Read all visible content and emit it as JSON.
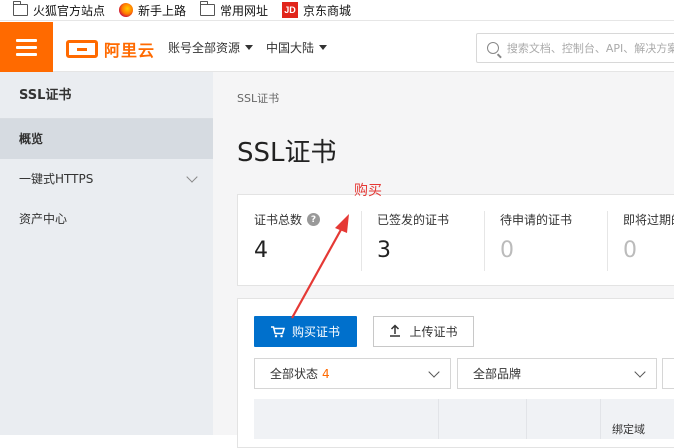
{
  "bookmarks": [
    {
      "label": "火狐官方站点",
      "icon": "folder-icon"
    },
    {
      "label": "新手上路",
      "icon": "firefox-icon"
    },
    {
      "label": "常用网址",
      "icon": "folder-icon"
    },
    {
      "label": "京东商城",
      "icon": "jd-icon",
      "icon_text": "JD"
    }
  ],
  "header": {
    "logo_text": "阿里云",
    "account_dropdown": "账号全部资源",
    "region_dropdown": "中国大陆",
    "search_placeholder": "搜索文档、控制台、API、解决方案和资源"
  },
  "sidebar": {
    "title": "SSL证书",
    "items": [
      {
        "label": "概览",
        "active": true
      },
      {
        "label": "一键式HTTPS",
        "expandable": true
      },
      {
        "label": "资产中心"
      }
    ]
  },
  "main": {
    "breadcrumb": "SSL证书",
    "title": "SSL证书",
    "stats": [
      {
        "label": "证书总数",
        "value": "4",
        "help": "?"
      },
      {
        "label": "已签发的证书",
        "value": "3"
      },
      {
        "label": "待申请的证书",
        "value": "0"
      },
      {
        "label": "即将过期的",
        "value": "0"
      }
    ],
    "buy_button": "购买证书",
    "upload_button": "上传证书",
    "filters": {
      "status_label": "全部状态",
      "status_count": "4",
      "brand_label": "全部品牌"
    },
    "table_header_partial": "绑定域"
  },
  "annotation": {
    "text": "购买",
    "color": "#e53935"
  },
  "colors": {
    "brand": "#ff6a00",
    "primary_button": "#0070cc",
    "sidebar_bg": "#eaedf1",
    "content_bg": "#f5f5f6"
  }
}
